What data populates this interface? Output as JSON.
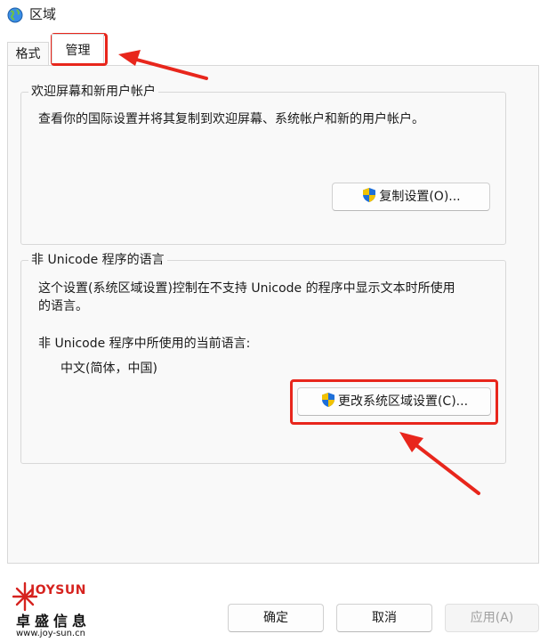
{
  "window": {
    "title": "区域"
  },
  "tabs": [
    {
      "label": "格式",
      "active": false
    },
    {
      "label": "管理",
      "active": true
    }
  ],
  "welcome_group": {
    "title": "欢迎屏幕和新用户帐户",
    "description": "查看你的国际设置并将其复制到欢迎屏幕、系统帐户和新的用户帐户。",
    "copy_button_label": "复制设置(O)..."
  },
  "non_unicode_group": {
    "title": "非 Unicode 程序的语言",
    "description_line1": "这个设置(系统区域设置)控制在不支持 Unicode 的程序中显示文本时所使用",
    "description_line2": "的语言。",
    "current_language_label": "非 Unicode 程序中所使用的当前语言:",
    "current_language_value": "中文(简体，中国)",
    "change_button_label": "更改系统区域设置(C)..."
  },
  "footer": {
    "ok_label": "确定",
    "cancel_label": "取消",
    "apply_label": "应用(A)"
  },
  "watermark": {
    "brand_en": "JOYSUN",
    "brand_cn": "卓盛信息",
    "url": "www.joy-sun.cn"
  },
  "colors": {
    "annotation_red": "#e8261c",
    "shield_blue": "#1e6fd9",
    "shield_yellow": "#f2c200",
    "brand_red": "#d6231f"
  }
}
